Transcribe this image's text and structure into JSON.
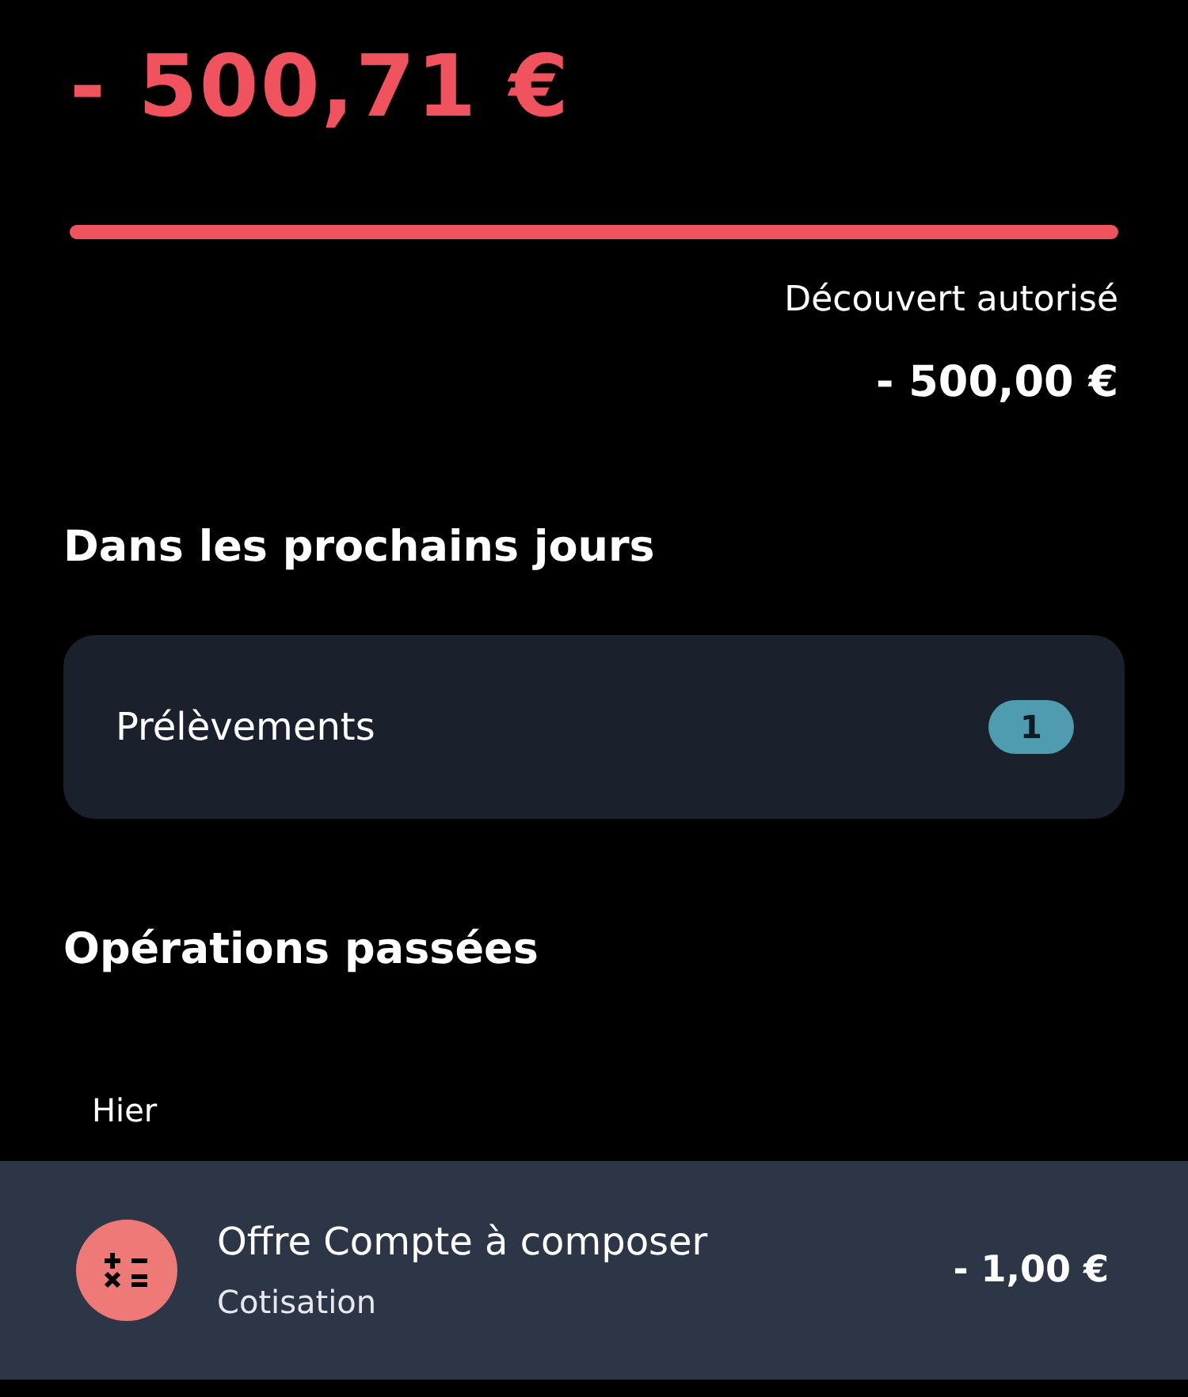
{
  "balance": {
    "amount": "- 500,71 €",
    "level": 1
  },
  "overdraft": {
    "label": "Découvert autorisé",
    "amount": "- 500,00 €"
  },
  "upcoming": {
    "title": "Dans les prochains jours",
    "items": [
      {
        "label": "Prélèvements",
        "count": "1"
      }
    ]
  },
  "past": {
    "title": "Opérations passées",
    "groups": [
      {
        "date": "Hier",
        "operations": [
          {
            "title": "Offre Compte à composer",
            "category": "Cotisation",
            "amount": "- 1,00 €"
          }
        ]
      }
    ]
  }
}
